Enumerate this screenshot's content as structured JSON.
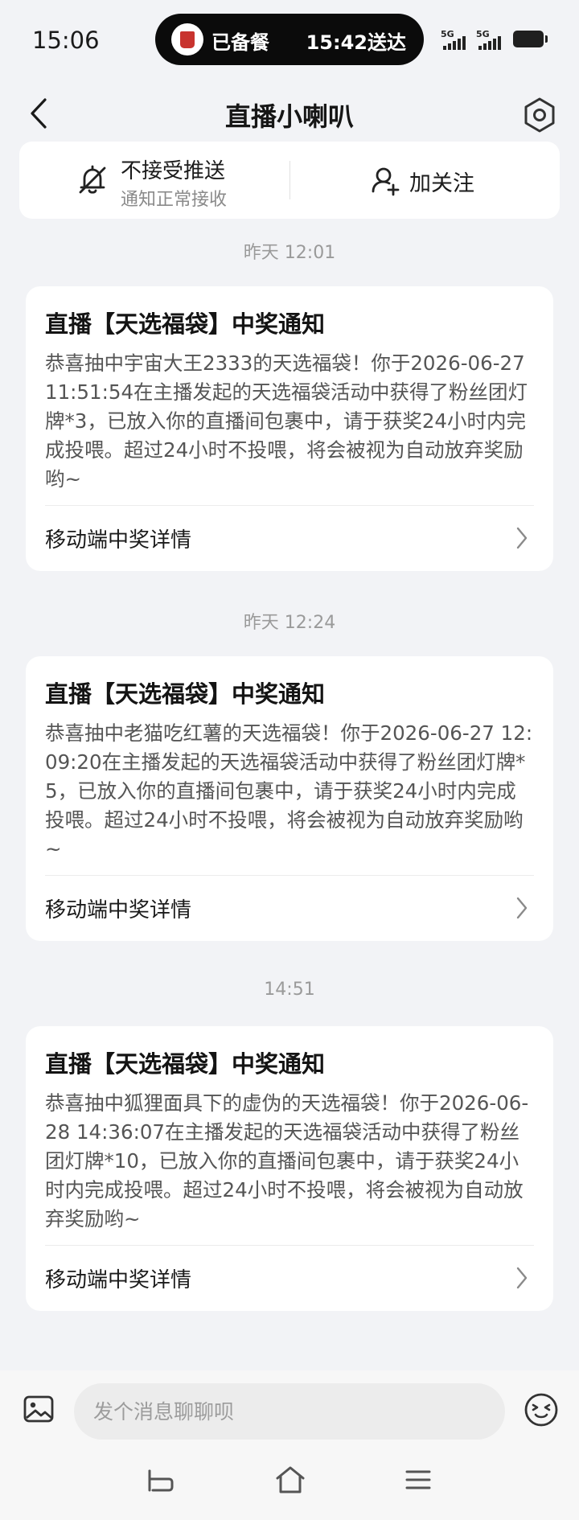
{
  "status_bar": {
    "time": "15:06",
    "island_status": "已备餐",
    "island_eta": "15:42送达",
    "signal_1": "5G",
    "signal_2": "5G"
  },
  "header": {
    "title": "直播小喇叭"
  },
  "push_panel": {
    "push_title": "不接受推送",
    "push_subtitle": "通知正常接收",
    "follow_label": "加关注"
  },
  "messages": [
    {
      "timestamp": "昨天 12:01",
      "title": "直播【天选福袋】中奖通知",
      "body": "恭喜抽中宇宙大王2333的天选福袋！你于2026-06-27 11:51:54在主播发起的天选福袋活动中获得了粉丝团灯牌*3，已放入你的直播间包裹中，请于获奖24小时内完成投喂。超过24小时不投喂，将会被视为自动放弃奖励哟~",
      "link": "移动端中奖详情"
    },
    {
      "timestamp": "昨天 12:24",
      "title": "直播【天选福袋】中奖通知",
      "body": "恭喜抽中老猫吃红薯的天选福袋！你于2026-06-27 12:09:20在主播发起的天选福袋活动中获得了粉丝团灯牌*5，已放入你的直播间包裹中，请于获奖24小时内完成投喂。超过24小时不投喂，将会被视为自动放弃奖励哟~",
      "link": "移动端中奖详情"
    },
    {
      "timestamp": "14:51",
      "title": "直播【天选福袋】中奖通知",
      "body": "恭喜抽中狐狸面具下的虚伪的天选福袋！你于2026-06-28 14:36:07在主播发起的天选福袋活动中获得了粉丝团灯牌*10，已放入你的直播间包裹中，请于获奖24小时内完成投喂。超过24小时不投喂，将会被视为自动放弃奖励哟~",
      "link": "移动端中奖详情"
    }
  ],
  "composer": {
    "placeholder": "发个消息聊聊呗"
  },
  "icons": {
    "back": "chevron-left-icon",
    "settings": "hexagon-settings-icon",
    "bell": "bell-off-icon",
    "follow": "add-follow-icon",
    "image": "image-icon",
    "emoji": "emoji-icon",
    "nav_back": "nav-back-icon",
    "nav_home": "home-icon",
    "nav_menu": "menu-icon"
  },
  "colors": {
    "background": "#f2f3f6",
    "card": "#ffffff",
    "island": "#0b0b0b"
  }
}
